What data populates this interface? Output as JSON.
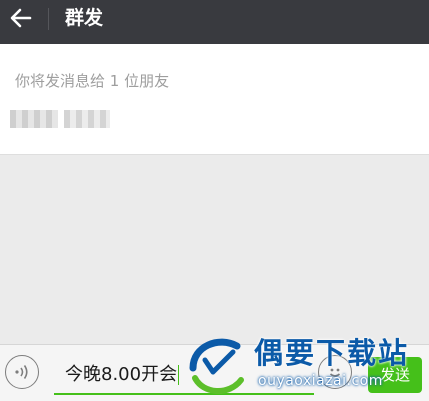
{
  "header": {
    "back_icon": "arrow-left-icon",
    "title": "群发"
  },
  "recipients": {
    "hint": "你将发消息给 1 位朋友"
  },
  "composer": {
    "voice_icon": "voice-icon",
    "message_text": "今晚8.00开会",
    "emoji_icon": "emoji-icon",
    "send_label": "发送"
  },
  "watermark": {
    "title": "偶要下载站",
    "url": "ouyaoxiazai.com"
  },
  "colors": {
    "titlebar_bg": "#393a3f",
    "accent_green": "#45c01a",
    "page_bg": "#ebebeb",
    "watermark_blue": "#0b5aa8"
  }
}
